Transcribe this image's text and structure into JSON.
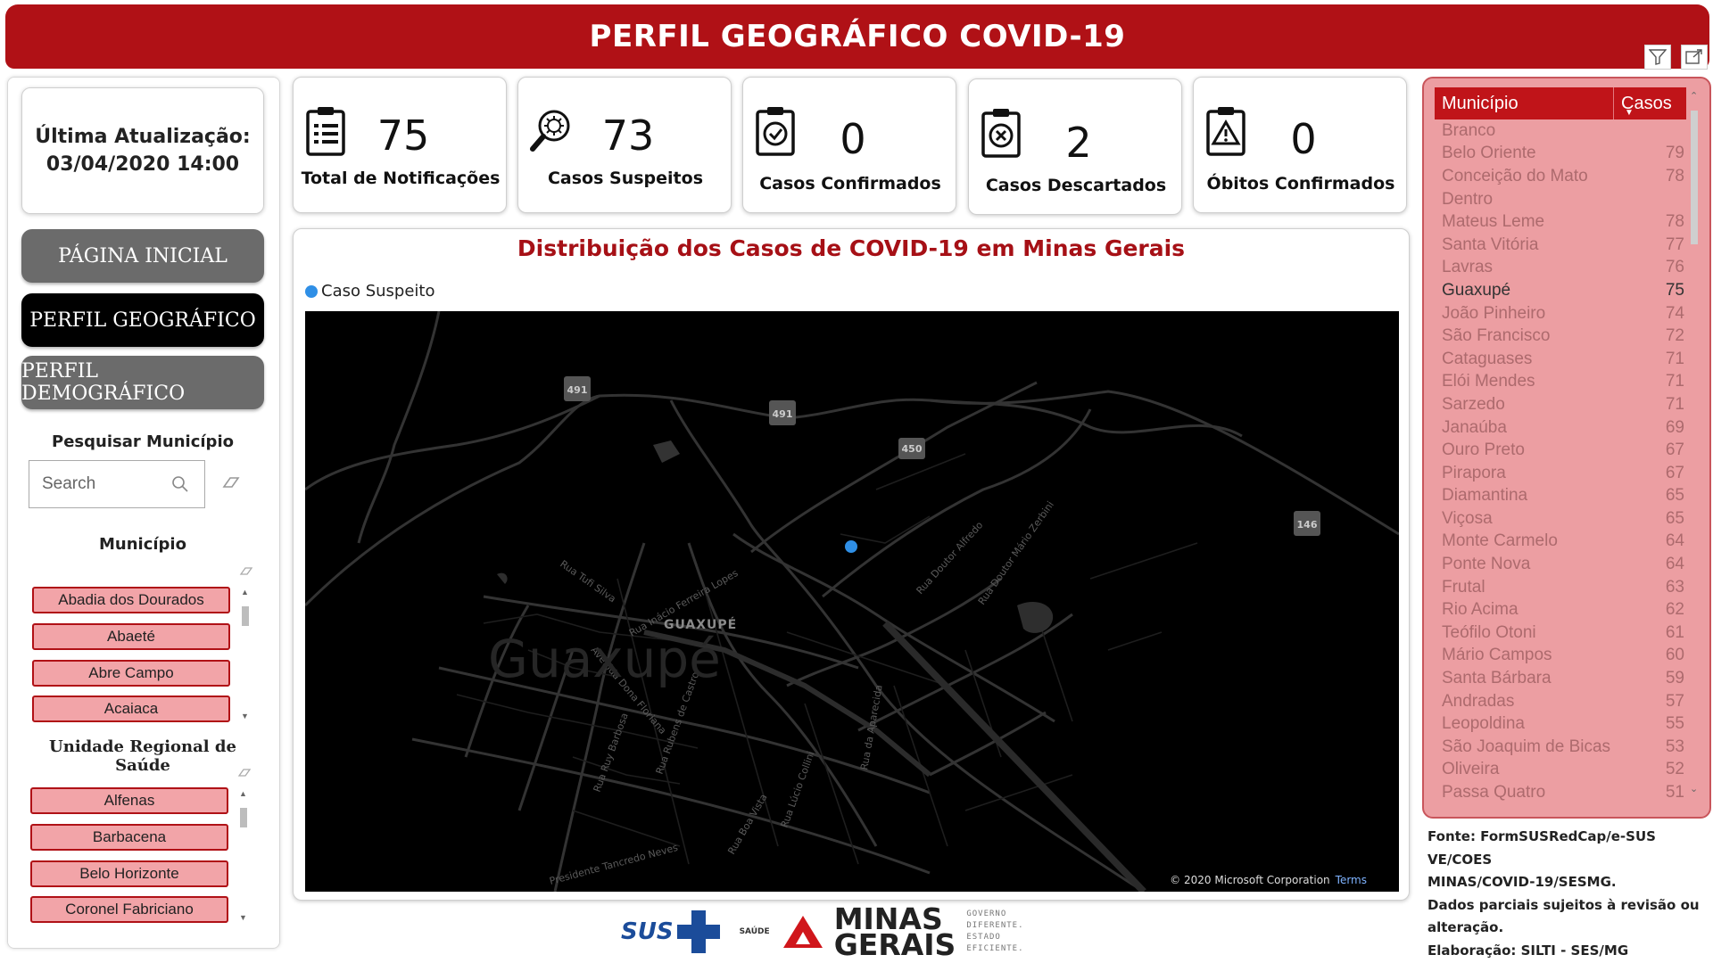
{
  "header": {
    "title": "PERFIL GEOGRÁFICO COVID-19",
    "filter_icon": "filter-icon",
    "expand_icon": "expand-icon"
  },
  "update": {
    "label": "Última Atualização:",
    "value": "03/04/2020 14:00"
  },
  "nav": [
    {
      "label": "PÁGINA INICIAL",
      "active": false
    },
    {
      "label": "PERFIL GEOGRÁFICO",
      "active": true
    },
    {
      "label": "PERFIL DEMOGRÁFICO",
      "active": false
    }
  ],
  "search": {
    "title": "Pesquisar Município",
    "placeholder": "Search"
  },
  "municipio_slicer": {
    "title": "Município",
    "items": [
      "Abadia dos Dourados",
      "Abaeté",
      "Abre Campo",
      "Acaiaca"
    ]
  },
  "urs_slicer": {
    "title": "Unidade Regional de Saúde",
    "items": [
      "Alfenas",
      "Barbacena",
      "Belo Horizonte",
      "Coronel Fabriciano"
    ]
  },
  "kpis": [
    {
      "value": "75",
      "label": "Total de Notificações",
      "icon": "clipboard-list-icon"
    },
    {
      "value": "73",
      "label": "Casos Suspeitos",
      "icon": "magnifier-virus-icon"
    },
    {
      "value": "0",
      "label": "Casos Confirmados",
      "icon": "clipboard-check-icon"
    },
    {
      "value": "2",
      "label": "Casos Descartados",
      "icon": "clipboard-x-icon"
    },
    {
      "value": "0",
      "label": "Óbitos Confirmados",
      "icon": "clipboard-warning-icon"
    }
  ],
  "map": {
    "title": "Distribuição dos Casos de COVID-19 em Minas Gerais",
    "legend": "Caso Suspeito",
    "legend_color": "#2f8fe6",
    "city_label": "GUAXUPÉ",
    "watermark": "Guaxupé",
    "road_shields": [
      "491",
      "491",
      "450",
      "146"
    ],
    "street_labels": [
      "Rua Tufi Silva",
      "Rua Inácio Ferreira Lopes",
      "Avenida Dona Floriana",
      "Rua Doutor Mário Zerbini",
      "Rua Doutor Alfredo",
      "Rua da Aparecida",
      "Rua Ruy Barbosa",
      "Rua Rubens de Castro",
      "Rua Boa Vista",
      "Rua Lúcio Collini",
      "Presidente Tancredo Neves"
    ],
    "copyright": "© 2020 Microsoft Corporation",
    "terms": "Terms"
  },
  "table": {
    "col_municipio": "Município",
    "col_casos": "Casos",
    "rows": [
      {
        "municipio": "Branco",
        "casos": ""
      },
      {
        "municipio": "Belo Oriente",
        "casos": "79"
      },
      {
        "municipio": "Conceição do Mato",
        "casos": "78"
      },
      {
        "municipio": "Dentro",
        "casos": ""
      },
      {
        "municipio": "Mateus Leme",
        "casos": "78"
      },
      {
        "municipio": "Santa Vitória",
        "casos": "77"
      },
      {
        "municipio": "Lavras",
        "casos": "76"
      },
      {
        "municipio": "Guaxupé",
        "casos": "75",
        "selected": true
      },
      {
        "municipio": "João Pinheiro",
        "casos": "74"
      },
      {
        "municipio": "São Francisco",
        "casos": "72"
      },
      {
        "municipio": "Cataguases",
        "casos": "71"
      },
      {
        "municipio": "Elói Mendes",
        "casos": "71"
      },
      {
        "municipio": "Sarzedo",
        "casos": "71"
      },
      {
        "municipio": "Janaúba",
        "casos": "69"
      },
      {
        "municipio": "Ouro Preto",
        "casos": "67"
      },
      {
        "municipio": "Pirapora",
        "casos": "67"
      },
      {
        "municipio": "Diamantina",
        "casos": "65"
      },
      {
        "municipio": "Viçosa",
        "casos": "65"
      },
      {
        "municipio": "Monte Carmelo",
        "casos": "64"
      },
      {
        "municipio": "Ponte Nova",
        "casos": "64"
      },
      {
        "municipio": "Frutal",
        "casos": "63"
      },
      {
        "municipio": "Rio Acima",
        "casos": "62"
      },
      {
        "municipio": "Teófilo Otoni",
        "casos": "61"
      },
      {
        "municipio": "Mário Campos",
        "casos": "60"
      },
      {
        "municipio": "Santa Bárbara",
        "casos": "59"
      },
      {
        "municipio": "Andradas",
        "casos": "57"
      },
      {
        "municipio": "Leopoldina",
        "casos": "55"
      },
      {
        "municipio": "São Joaquim de Bicas",
        "casos": "53"
      },
      {
        "municipio": "Oliveira",
        "casos": "52"
      },
      {
        "municipio": "Passa Quatro",
        "casos": "51"
      }
    ]
  },
  "footer": {
    "lines": [
      "Fonte: FormSUSRedCap/e-SUS VE/COES",
      "MINAS/COVID-19/SESMG.",
      "Dados parciais sujeitos à revisão ou",
      "alteração.",
      "Elaboração: SILTI - SES/MG"
    ]
  },
  "logos": {
    "sus": "SUS",
    "saude": "SAÚDE",
    "minas": "MINAS",
    "gerais": "GERAIS",
    "tagline": [
      "GOVERNO",
      "DIFERENTE.",
      "ESTADO",
      "EFICIENTE."
    ]
  }
}
